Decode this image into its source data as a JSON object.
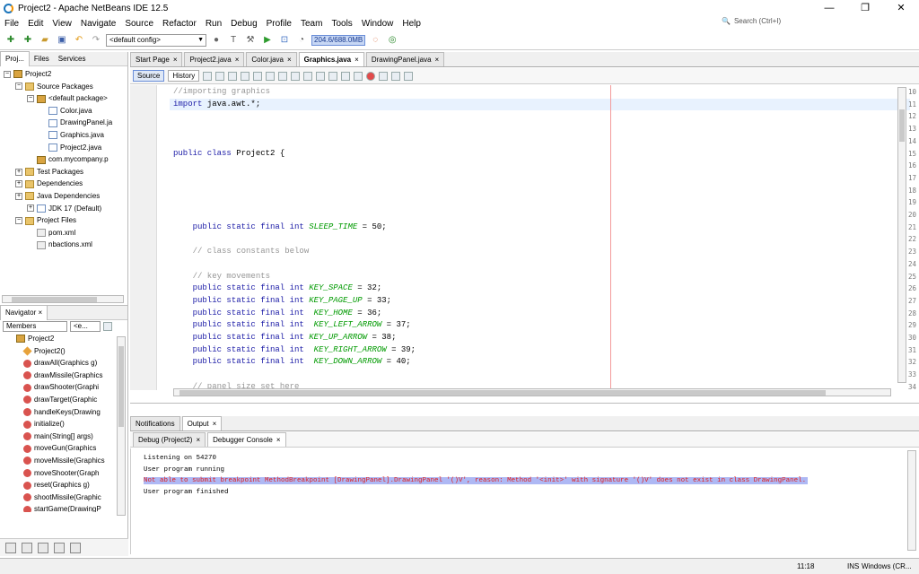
{
  "window": {
    "title": "Project2 - Apache NetBeans IDE 12.5",
    "min": "—",
    "max": "❐",
    "close": "✕"
  },
  "menu": [
    "File",
    "Edit",
    "View",
    "Navigate",
    "Source",
    "Refactor",
    "Run",
    "Debug",
    "Profile",
    "Team",
    "Tools",
    "Window",
    "Help"
  ],
  "search": {
    "placeholder": "Search (Ctrl+I)"
  },
  "toolbar": {
    "config": "<default config>",
    "memory": "204.6/688.0MB"
  },
  "left_tabs": [
    "Proj...",
    "Files",
    "Services"
  ],
  "tree": [
    {
      "indent": 0,
      "toggle": "−",
      "icon": "pkg",
      "label": "Project2"
    },
    {
      "indent": 1,
      "toggle": "−",
      "icon": "folder",
      "label": "Source Packages"
    },
    {
      "indent": 2,
      "toggle": "−",
      "icon": "pkg",
      "label": "<default package>"
    },
    {
      "indent": 3,
      "toggle": "",
      "icon": "java",
      "label": "Color.java"
    },
    {
      "indent": 3,
      "toggle": "",
      "icon": "java",
      "label": "DrawingPanel.ja"
    },
    {
      "indent": 3,
      "toggle": "",
      "icon": "java",
      "label": "Graphics.java"
    },
    {
      "indent": 3,
      "toggle": "",
      "icon": "java",
      "label": "Project2.java"
    },
    {
      "indent": 2,
      "toggle": "",
      "icon": "pkg",
      "label": "com.mycompany.p"
    },
    {
      "indent": 1,
      "toggle": "+",
      "icon": "folder",
      "label": "Test Packages"
    },
    {
      "indent": 1,
      "toggle": "+",
      "icon": "folder",
      "label": "Dependencies"
    },
    {
      "indent": 1,
      "toggle": "+",
      "icon": "folder",
      "label": "Java Dependencies"
    },
    {
      "indent": 2,
      "toggle": "+",
      "icon": "java",
      "label": "JDK 17 (Default)"
    },
    {
      "indent": 1,
      "toggle": "−",
      "icon": "folder",
      "label": "Project Files"
    },
    {
      "indent": 2,
      "toggle": "",
      "icon": "xml",
      "label": "pom.xml"
    },
    {
      "indent": 2,
      "toggle": "",
      "icon": "xml",
      "label": "nbactions.xml"
    }
  ],
  "navigator": {
    "title": "Navigator",
    "close": "×",
    "filter": "Members",
    "filter2": "<e...",
    "items": [
      {
        "kind": "class",
        "label": "Project2"
      },
      {
        "kind": "ctor",
        "label": "Project2()"
      },
      {
        "kind": "m",
        "label": "drawAll(Graphics g)"
      },
      {
        "kind": "m",
        "label": "drawMissile(Graphics"
      },
      {
        "kind": "m",
        "label": "drawShooter(Graphi"
      },
      {
        "kind": "m",
        "label": "drawTarget(Graphic"
      },
      {
        "kind": "m",
        "label": "handleKeys(Drawing"
      },
      {
        "kind": "m",
        "label": "initialize()"
      },
      {
        "kind": "m",
        "label": "main(String[] args)"
      },
      {
        "kind": "m",
        "label": "moveGun(Graphics"
      },
      {
        "kind": "m",
        "label": "moveMissile(Graphics"
      },
      {
        "kind": "m",
        "label": "moveShooter(Graph"
      },
      {
        "kind": "m",
        "label": "reset(Graphics g)"
      },
      {
        "kind": "m",
        "label": "shootMissile(Graphic"
      },
      {
        "kind": "m",
        "label": "startGame(DrawingP"
      }
    ]
  },
  "editor_tabs": [
    {
      "label": "Start Page",
      "active": false
    },
    {
      "label": "Project2.java",
      "active": false
    },
    {
      "label": "Color.java",
      "active": false
    },
    {
      "label": "Graphics.java",
      "active": true
    },
    {
      "label": "DrawingPanel.java",
      "active": false
    }
  ],
  "tab_close": "×",
  "source_tabs": [
    "Source",
    "History"
  ],
  "code": [
    {
      "n": "10",
      "html": "<span class='cm'>//importing graphics</span>"
    },
    {
      "n": "11",
      "html": "<span class='kw'>import</span> java.awt.*;"
    },
    {
      "n": "12",
      "html": ""
    },
    {
      "n": "13",
      "html": ""
    },
    {
      "n": "14",
      "html": ""
    },
    {
      "n": "15",
      "html": "<span class='kw'>public class</span> Project2 {"
    },
    {
      "n": "16",
      "html": ""
    },
    {
      "n": "17",
      "html": ""
    },
    {
      "n": "18",
      "html": ""
    },
    {
      "n": "19",
      "html": ""
    },
    {
      "n": "20",
      "html": ""
    },
    {
      "n": "21",
      "html": "    <span class='kw'>public static final int</span> <span class='const'>SLEEP_TIME</span> = 50;"
    },
    {
      "n": "22",
      "html": ""
    },
    {
      "n": "23",
      "html": "    <span class='cm'>// class constants below</span>"
    },
    {
      "n": "24",
      "html": ""
    },
    {
      "n": "25",
      "html": "    <span class='cm'>// key movements</span>"
    },
    {
      "n": "26",
      "html": "    <span class='kw'>public static final int</span> <span class='const'>KEY_SPACE</span> = 32;"
    },
    {
      "n": "27",
      "html": "    <span class='kw'>public static final int</span> <span class='const'>KEY_PAGE_UP</span> = 33;"
    },
    {
      "n": "28",
      "html": "    <span class='kw'>public static final int</span>  <span class='const'>KEY_HOME</span> = 36;"
    },
    {
      "n": "29",
      "html": "    <span class='kw'>public static final int</span>  <span class='const'>KEY_LEFT_ARROW</span> = 37;"
    },
    {
      "n": "30",
      "html": "    <span class='kw'>public static final int</span> <span class='const'>KEY_UP_ARROW</span> = 38;"
    },
    {
      "n": "31",
      "html": "    <span class='kw'>public static final int</span>  <span class='const'>KEY_RIGHT_ARROW</span> = 39;"
    },
    {
      "n": "32",
      "html": "    <span class='kw'>public static final int</span>  <span class='const'>KEY_DOWN_ARROW</span> = 40;"
    },
    {
      "n": "33",
      "html": ""
    },
    {
      "n": "34",
      "html": "    <span class='cm'>// panel size set here</span>"
    }
  ],
  "output_tabs": [
    {
      "label": "Notifications",
      "active": false,
      "close": false
    },
    {
      "label": "Output",
      "active": true,
      "close": true
    }
  ],
  "sub_tabs": [
    {
      "label": "Debug (Project2)",
      "active": false
    },
    {
      "label": "Debugger Console",
      "active": true
    }
  ],
  "console": [
    {
      "text": "Listening on 54270",
      "error": false
    },
    {
      "text": "User program running",
      "error": false
    },
    {
      "text": "Not able to submit breakpoint MethodBreakpoint [DrawingPanel].DrawingPanel '()V', reason: Method '<init>' with signature '()V' does not exist in class DrawingPanel.",
      "error": true
    },
    {
      "text": "User program finished",
      "error": false
    }
  ],
  "status": {
    "position": "11:18",
    "mode": "INS",
    "lineend": "Windows (CR..."
  },
  "colors": {
    "accent": "#1b75bb",
    "error": "#e02020",
    "error_bg": "#aeb8f4"
  }
}
